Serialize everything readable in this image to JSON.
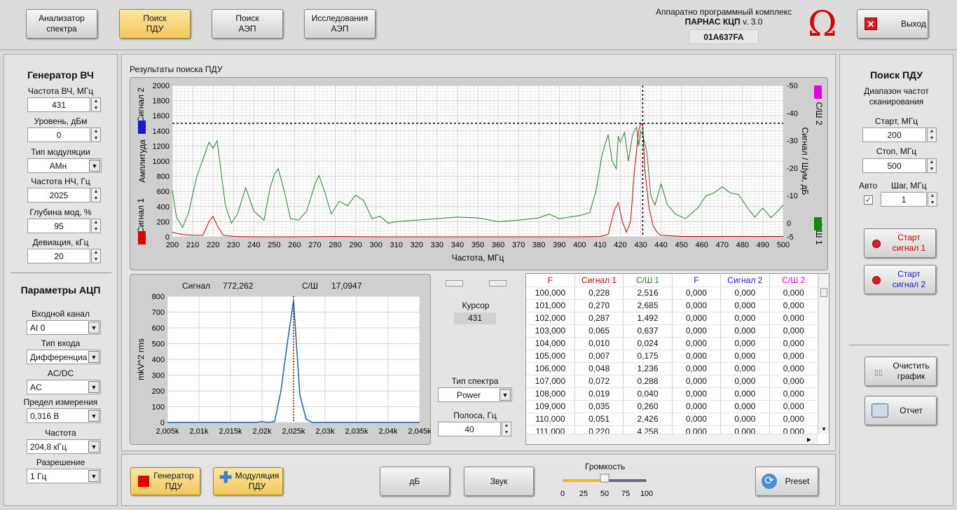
{
  "topbar": {
    "buttons": [
      "Анализатор\nспектра",
      "Поиск\nПДУ",
      "Поиск\nАЭП",
      "Исследования\nАЭП"
    ],
    "company": "Аппаратно программный комплекс",
    "product_name": "ПАРНАС КЦП",
    "product_version": "v. 3.0",
    "serial": "01A637FA",
    "exit": "Выход"
  },
  "generator": {
    "title": "Генератор ВЧ",
    "freq_label": "Частота ВЧ, МГц",
    "freq": "431",
    "level_label": "Уровень, дБм",
    "level": "0",
    "mod_type_label": "Тип модуляции",
    "mod_type": "АМн",
    "lf_label": "Частота НЧ, Гц",
    "lf": "2025",
    "depth_label": "Глубина мод, %",
    "depth": "95",
    "dev_label": "Девиация, кГц",
    "dev": "20"
  },
  "adc": {
    "title": "Параметры АЦП",
    "channel_label": "Входной канал",
    "channel": "AI 0",
    "input_type_label": "Тип входа",
    "input_type": "Дифференциа",
    "acdc_label": "AC/DC",
    "acdc": "AC",
    "range_label": "Предел измерения",
    "range": "0,316 В",
    "freq_label": "Частота",
    "freq": "204,8 кГц",
    "res_label": "Разрешение",
    "res": "1 Гц"
  },
  "search": {
    "title": "Поиск ПДУ",
    "range_title": "Диапазон частот\nсканирования",
    "start_label": "Старт, МГц",
    "start": "200",
    "stop_label": "Стоп, МГц",
    "stop": "500",
    "auto_label": "Авто",
    "step_label": "Шаг, МГц",
    "step": "1",
    "start1": "Старт\nсигнал 1",
    "start2": "Старт\nсигнал 2",
    "clear": "Очистить\nграфик",
    "report": "Отчет"
  },
  "main_chart": {
    "title": "Результаты поиска ПДУ",
    "ylabel_left": "Амплитуда",
    "sig1": "Сигнал 1",
    "sig2": "Сигнал 2",
    "ylabel_right": "Сигнал / Шум, дБ",
    "snr1": "С/Ш 1",
    "snr2": "С/Ш 2",
    "xlabel": "Частота, МГц",
    "xticks": [
      "200",
      "210",
      "220",
      "230",
      "240",
      "250",
      "260",
      "270",
      "280",
      "290",
      "300",
      "310",
      "320",
      "330",
      "340",
      "350",
      "360",
      "370",
      "380",
      "390",
      "400",
      "410",
      "420",
      "430",
      "440",
      "450",
      "460",
      "470",
      "480",
      "490",
      "500"
    ],
    "yticks_left": [
      "2000",
      "1800",
      "1600",
      "1400",
      "1200",
      "1000",
      "800",
      "600",
      "400",
      "200",
      "0"
    ],
    "yticks_right": [
      "-50",
      "-40",
      "-30",
      "-20",
      "-10",
      "0",
      "-5"
    ]
  },
  "spectrum": {
    "signal_label": "Сигнал",
    "signal": "772,262",
    "snr_label": "С/Ш",
    "snr": "17,0947",
    "ylabel": "mkV^2 rms",
    "yticks": [
      "800",
      "700",
      "600",
      "500",
      "400",
      "300",
      "200",
      "100",
      "0"
    ],
    "xticks": [
      "2,005k",
      "2,01k",
      "2,015k",
      "2,02k",
      "2,025k",
      "2,03k",
      "2,035k",
      "2,04k",
      "2,045k"
    ]
  },
  "cursor": {
    "label": "Курсор",
    "value": "431",
    "spectrum_type_label": "Тип спектра",
    "spectrum_type": "Power",
    "band_label": "Полоса, Гц",
    "band": "40"
  },
  "table": {
    "headers": [
      "F",
      "Сигнал 1",
      "С/Ш 1",
      "F",
      "Сигнал 2",
      "С/Ш 2"
    ],
    "rows": [
      [
        "100,000",
        "0,228",
        "2,516",
        "0,000",
        "0,000",
        "0,000"
      ],
      [
        "101,000",
        "0,270",
        "2,685",
        "0,000",
        "0,000",
        "0,000"
      ],
      [
        "102,000",
        "0,287",
        "1,492",
        "0,000",
        "0,000",
        "0,000"
      ],
      [
        "103,000",
        "0,065",
        "0,637",
        "0,000",
        "0,000",
        "0,000"
      ],
      [
        "104,000",
        "0,010",
        "0,024",
        "0,000",
        "0,000",
        "0,000"
      ],
      [
        "105,000",
        "0,007",
        "0,175",
        "0,000",
        "0,000",
        "0,000"
      ],
      [
        "106,000",
        "0,048",
        "1,236",
        "0,000",
        "0,000",
        "0,000"
      ],
      [
        "107,000",
        "0,072",
        "0,288",
        "0,000",
        "0,000",
        "0,000"
      ],
      [
        "108,000",
        "0,019",
        "0,040",
        "0,000",
        "0,000",
        "0,000"
      ],
      [
        "109,000",
        "0,035",
        "0,260",
        "0,000",
        "0,000",
        "0,000"
      ],
      [
        "110,000",
        "0,051",
        "2,426",
        "0,000",
        "0,000",
        "0,000"
      ],
      [
        "111,000",
        "0,220",
        "4,258",
        "0,000",
        "0,000",
        "0,000"
      ]
    ]
  },
  "bottom": {
    "gen": "Генератор\nПДУ",
    "mod": "Модуляция\nПДУ",
    "db": "дБ",
    "sound": "Звук",
    "volume_label": "Громкость",
    "volume_ticks": [
      "0",
      "25",
      "50",
      "75",
      "100"
    ],
    "volume": 50,
    "preset": "Preset"
  },
  "chart_data": [
    {
      "type": "line",
      "title": "Результаты поиска ПДУ",
      "xlabel": "Частота, МГц",
      "ylabel": "Амплитуда",
      "y2label": "Сигнал / Шум, дБ",
      "xlim": [
        200,
        500
      ],
      "ylim": [
        0,
        2000
      ],
      "cursor_x": 431,
      "cursor_y": 1500,
      "series": [
        {
          "name": "Сигнал 1",
          "color": "#c00000",
          "x": [
            200,
            205,
            210,
            215,
            218,
            220,
            222,
            225,
            230,
            240,
            260,
            280,
            300,
            350,
            400,
            410,
            414,
            417,
            419,
            421,
            423,
            425,
            427,
            429,
            430,
            431,
            432,
            434,
            436,
            438,
            440,
            450,
            480,
            500
          ],
          "y": [
            60,
            30,
            20,
            20,
            200,
            270,
            150,
            20,
            5,
            0,
            0,
            5,
            0,
            0,
            0,
            5,
            30,
            350,
            450,
            200,
            60,
            200,
            900,
            1400,
            1500,
            1480,
            900,
            400,
            150,
            60,
            20,
            5,
            5,
            5
          ]
        },
        {
          "name": "С/Ш 1",
          "color": "#2e7d32",
          "x": [
            200,
            202,
            205,
            208,
            212,
            215,
            218,
            220,
            222,
            226,
            229,
            232,
            236,
            240,
            245,
            248,
            250,
            252,
            255,
            258,
            262,
            266,
            270,
            272,
            275,
            278,
            282,
            286,
            290,
            294,
            298,
            302,
            306,
            310,
            320,
            330,
            340,
            350,
            360,
            370,
            380,
            385,
            390,
            395,
            400,
            405,
            408,
            411,
            414,
            416,
            418,
            419,
            420,
            422,
            424,
            426,
            428,
            429,
            430,
            431,
            433,
            435,
            437,
            440,
            443,
            447,
            452,
            458,
            462,
            466,
            470,
            474,
            478,
            482,
            486,
            490,
            494,
            498,
            500
          ],
          "y": [
            620,
            260,
            120,
            320,
            800,
            1020,
            1250,
            1170,
            1270,
            420,
            180,
            300,
            650,
            340,
            220,
            640,
            820,
            900,
            600,
            240,
            220,
            340,
            690,
            810,
            580,
            300,
            470,
            410,
            550,
            480,
            240,
            270,
            180,
            200,
            220,
            240,
            260,
            250,
            200,
            220,
            250,
            300,
            240,
            260,
            280,
            320,
            600,
            1080,
            1350,
            1000,
            900,
            1330,
            1250,
            1380,
            1000,
            1350,
            1450,
            1200,
            1400,
            1350,
            1120,
            540,
            420,
            700,
            430,
            300,
            240,
            380,
            540,
            580,
            660,
            580,
            560,
            400,
            260,
            380,
            250,
            360,
            420
          ]
        }
      ]
    },
    {
      "type": "line",
      "title": "",
      "xlabel": "",
      "ylabel": "mkV^2 rms",
      "xlim": [
        2005,
        2045
      ],
      "ylim": [
        0,
        800
      ],
      "cursor_x": 2025,
      "series": [
        {
          "name": "",
          "color": "#1f5fa8",
          "x": [
            2005,
            2019,
            2020,
            2021,
            2022,
            2023,
            2024,
            2025,
            2026,
            2027,
            2028,
            2045
          ],
          "y": [
            0,
            0,
            5,
            0,
            5,
            200,
            500,
            772,
            175,
            20,
            0,
            0
          ]
        }
      ]
    }
  ],
  "colors": {
    "accent": "#f2c85a",
    "signal1": "#c00000",
    "signal2": "#1a1acc",
    "snr1": "#2e7d32",
    "snr2": "#e000e0"
  }
}
